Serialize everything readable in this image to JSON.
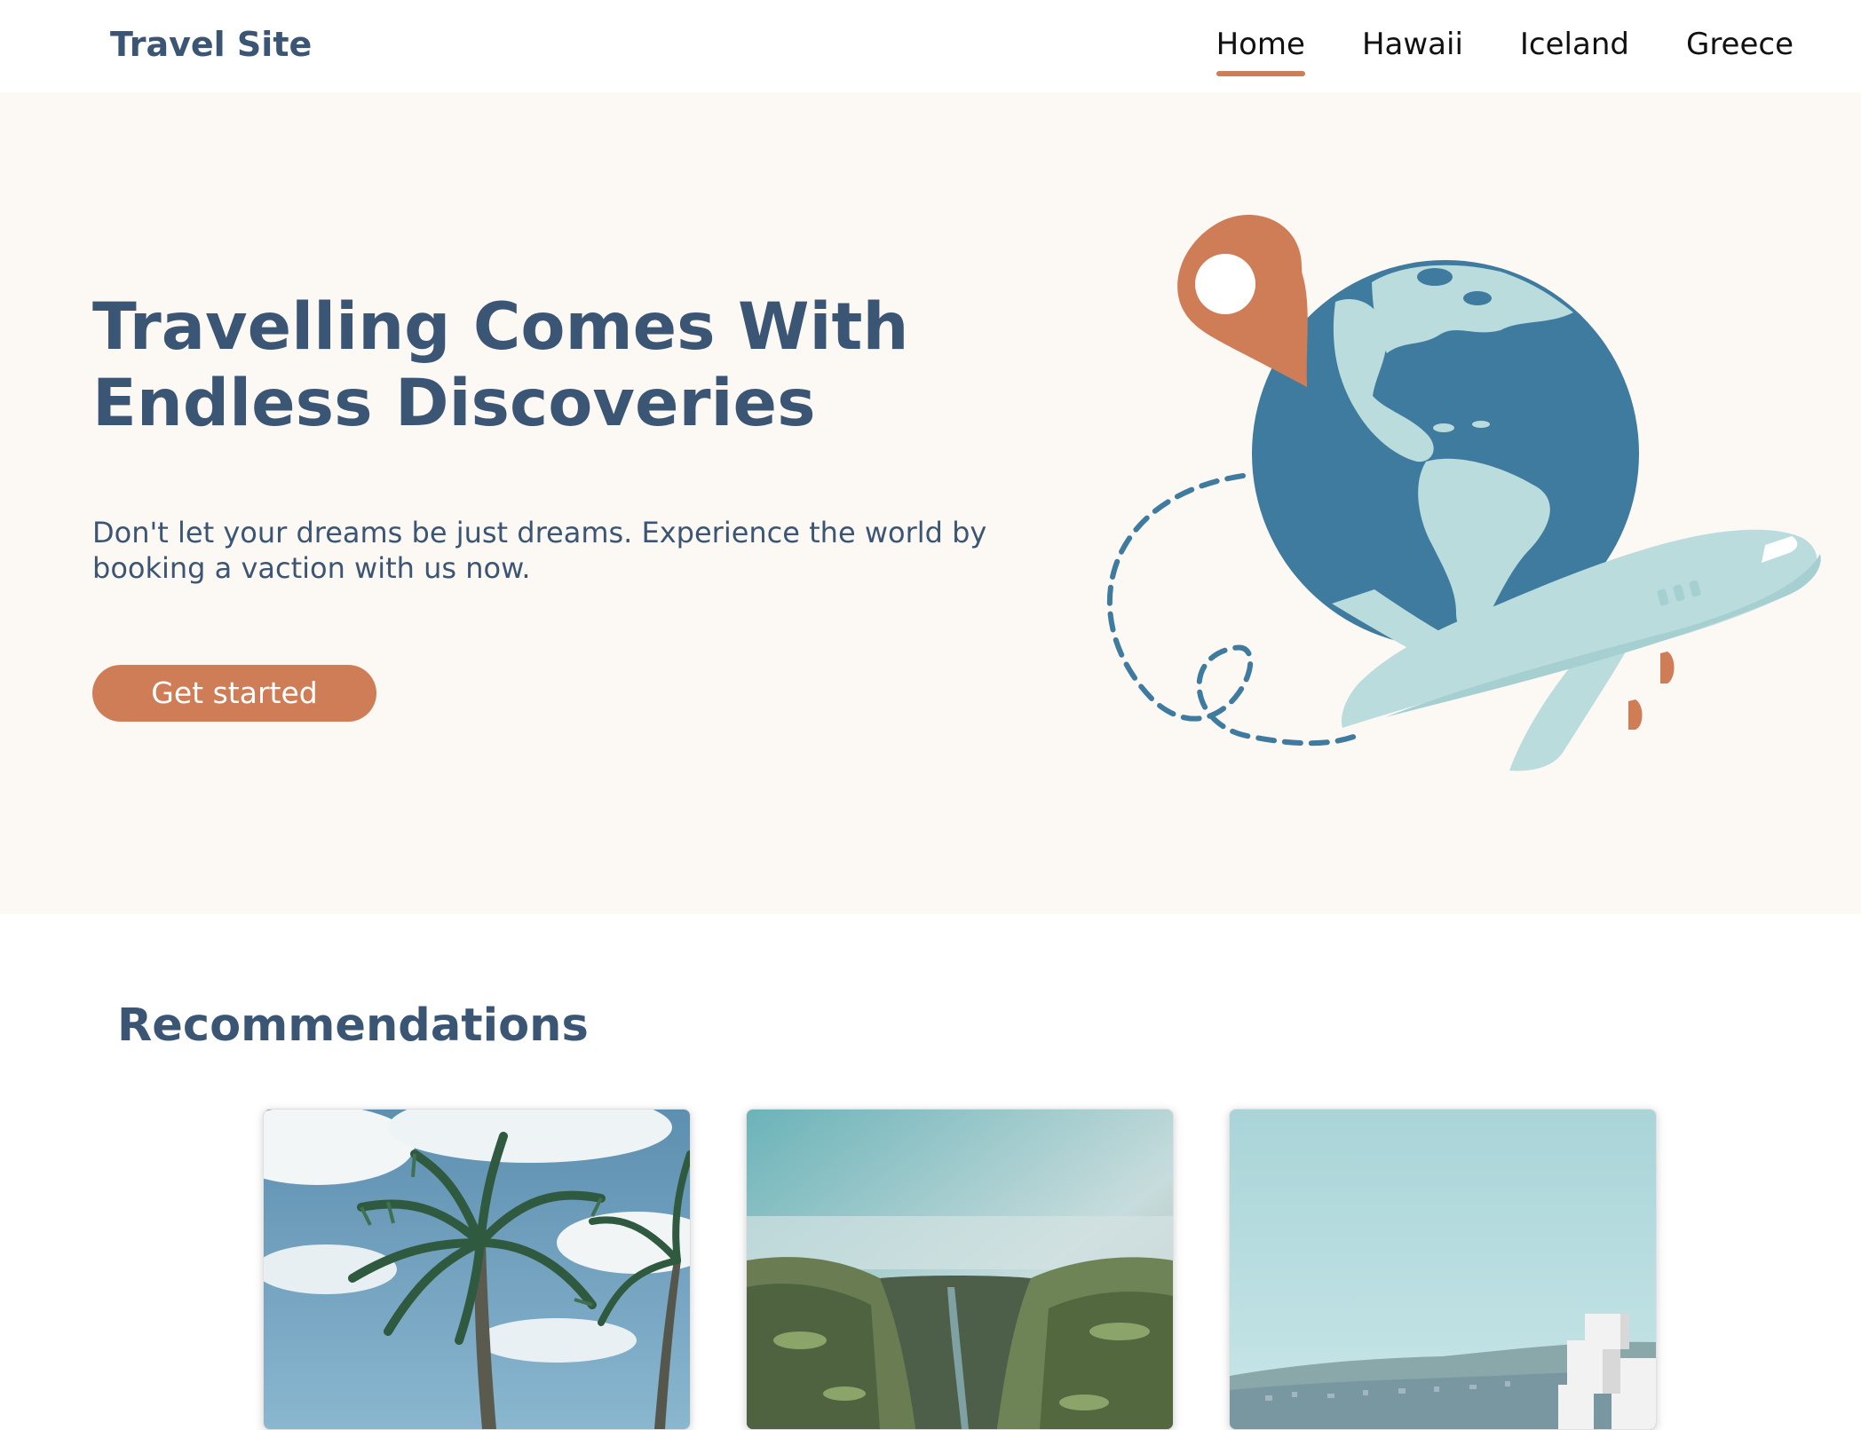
{
  "header": {
    "brand": "Travel Site",
    "nav": [
      {
        "label": "Home",
        "active": true
      },
      {
        "label": "Hawaii",
        "active": false
      },
      {
        "label": "Iceland",
        "active": false
      },
      {
        "label": "Greece",
        "active": false
      }
    ]
  },
  "hero": {
    "title": "Travelling Comes With Endless Discoveries",
    "subtitle": "Don't let your dreams be just dreams. Experience the world by booking a vaction with us now.",
    "cta_label": "Get started",
    "illustration": [
      "location-pin-icon",
      "globe-icon",
      "airplane-icon",
      "dashed-flight-path"
    ]
  },
  "recommendations": {
    "title": "Recommendations",
    "cards": [
      {
        "image": "palm-trees-photo"
      },
      {
        "image": "canyon-photo"
      },
      {
        "image": "coastal-city-photo"
      }
    ]
  },
  "colors": {
    "primary_text": "#3b5575",
    "accent": "#ce7d56",
    "hero_background": "#fcf8f4",
    "globe_blue": "#3e7b9e",
    "light_teal": "#badcdd"
  }
}
